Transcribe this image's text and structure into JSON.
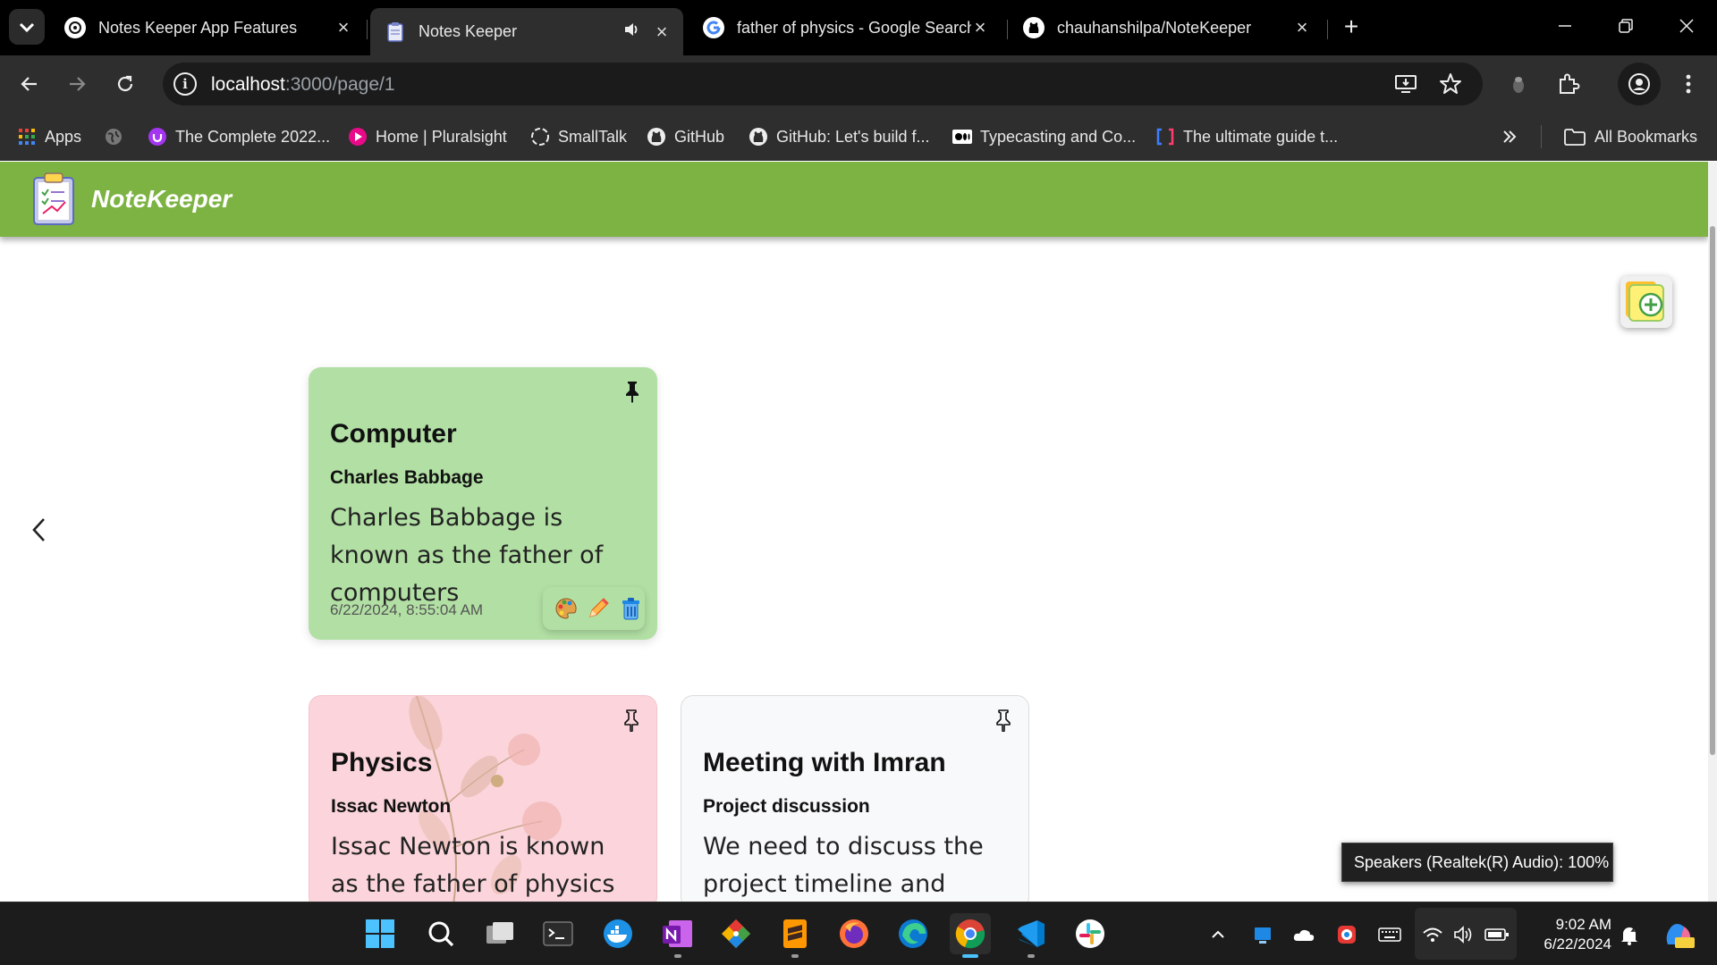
{
  "browser": {
    "tabs": [
      {
        "label": "Notes Keeper App Features",
        "icon": "chatgpt-icon",
        "active": false
      },
      {
        "label": "Notes Keeper",
        "icon": "notepad-icon",
        "active": true,
        "audio": true
      },
      {
        "label": "father of physics - Google Search",
        "icon": "google-icon",
        "active": false
      },
      {
        "label": "chauhanshilpa/NoteKeeper",
        "icon": "github-icon",
        "active": false
      }
    ],
    "address": {
      "host": "localhost",
      "path": ":3000/page/1"
    },
    "bookmarks": [
      {
        "label": "Apps",
        "icon": "apps-grid-icon"
      },
      {
        "label": "",
        "icon": "globe-icon"
      },
      {
        "label": "The Complete 2022...",
        "icon": "udemy-icon"
      },
      {
        "label": "Home | Pluralsight",
        "icon": "pluralsight-icon"
      },
      {
        "label": "SmallTalk",
        "icon": "smalltalk-icon"
      },
      {
        "label": "GitHub",
        "icon": "github-icon"
      },
      {
        "label": "GitHub: Let's build f...",
        "icon": "github-icon"
      },
      {
        "label": "Typecasting and Co...",
        "icon": "medium-icon"
      },
      {
        "label": "The ultimate guide t...",
        "icon": "bracket-icon"
      }
    ],
    "all_bookmarks_label": "All Bookmarks"
  },
  "app": {
    "brand": "NoteKeeper",
    "header_color": "#7cb342",
    "notes": [
      {
        "title": "Computer",
        "subtitle": "Charles Babbage",
        "body": "Charles Babbage is known as the father of computers",
        "date": "6/22/2024, 8:55:04 AM",
        "pinned": true,
        "color": "#b2e0a4"
      },
      {
        "title": "Physics",
        "subtitle": "Issac Newton",
        "body": "Issac Newton is known as the father of physics",
        "pinned": false,
        "color": "#fbd5db",
        "background": "floral-image"
      },
      {
        "title": "Meeting with Imran",
        "subtitle": "Project discussion",
        "body": "We need to discuss the project timeline and",
        "pinned": false,
        "color": "#f8f9fa"
      }
    ]
  },
  "tooltip": "Speakers (Realtek(R) Audio): 100%",
  "taskbar": {
    "apps": [
      "windows-start-icon",
      "search-icon",
      "task-view-icon",
      "terminal-icon",
      "docker-icon",
      "onenote-icon",
      "git-icon",
      "sublime-icon",
      "firefox-icon",
      "edge-icon",
      "chrome-icon",
      "vscode-icon",
      "slack-icon"
    ],
    "time": "9:02 AM",
    "date": "6/22/2024"
  }
}
